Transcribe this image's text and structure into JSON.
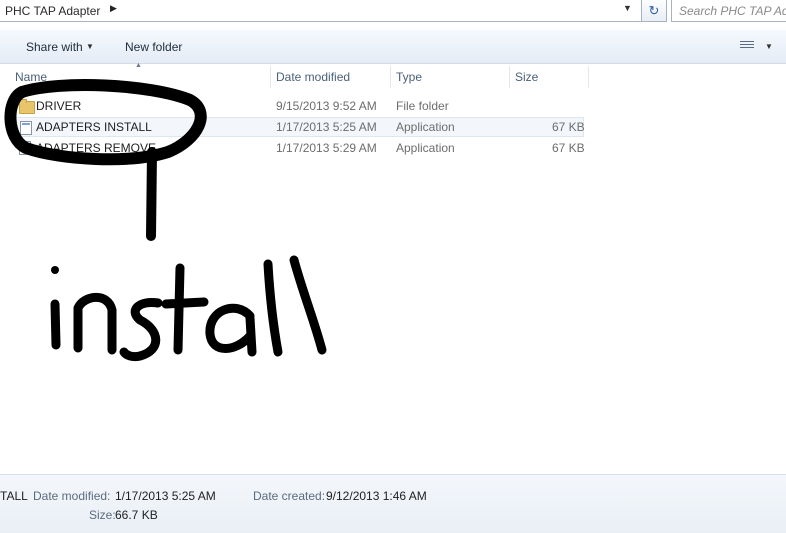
{
  "address": {
    "path": "PHC TAP Adapter"
  },
  "search": {
    "placeholder": "Search PHC TAP Adapter"
  },
  "toolbar": {
    "share_label": "Share with",
    "new_folder_label": "New folder"
  },
  "columns": {
    "name": "Name",
    "date": "Date modified",
    "type": "Type",
    "size": "Size"
  },
  "files": [
    {
      "name": "DRIVER",
      "date": "9/15/2013 9:52 AM",
      "type": "File folder",
      "size": "",
      "icon": "folder-icon"
    },
    {
      "name": "ADAPTERS INSTALL",
      "date": "1/17/2013 5:25 AM",
      "type": "Application",
      "size": "67 KB",
      "icon": "application-icon"
    },
    {
      "name": "ADAPTERS REMOVE",
      "date": "1/17/2013 5:29 AM",
      "type": "Application",
      "size": "67 KB",
      "icon": "application-icon"
    }
  ],
  "annotation": {
    "text": "install"
  },
  "details": {
    "name": "TALL",
    "date_modified_label": "Date modified:",
    "date_modified": "1/17/2013 5:25 AM",
    "date_created_label": "Date created:",
    "date_created": "9/12/2013 1:46 AM",
    "size_label": "Size:",
    "size": "66.7 KB"
  },
  "colors": {
    "header_text": "#4c607a",
    "toolbar_bg": "#e4ecf6",
    "ink": "#000000"
  }
}
